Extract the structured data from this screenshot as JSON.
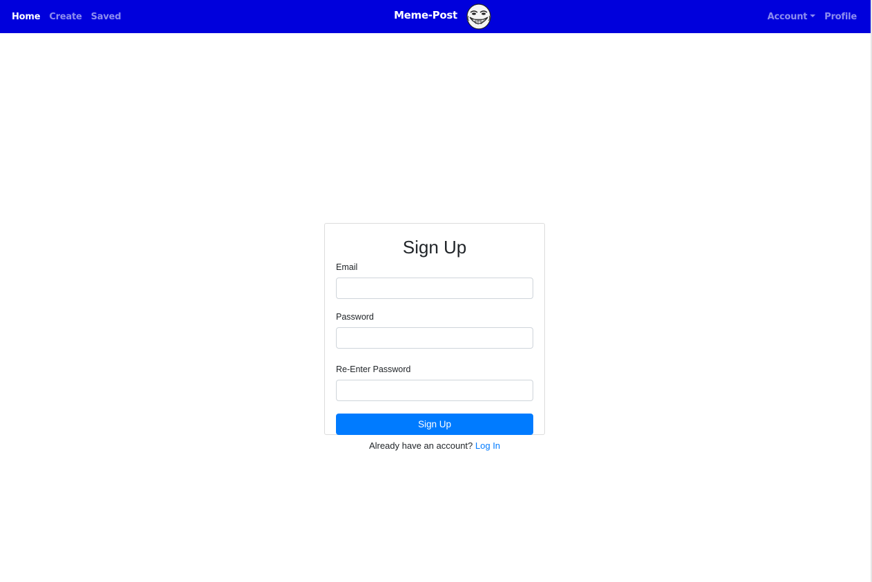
{
  "navbar": {
    "left_links": [
      {
        "label": "Home",
        "active": true
      },
      {
        "label": "Create",
        "active": false
      },
      {
        "label": "Saved",
        "active": false
      }
    ],
    "brand": "Meme-Post",
    "brand_logo_icon": "trollface-icon",
    "account_label": "Account",
    "profile_label": "Profile",
    "background_color": "#0000dc"
  },
  "form": {
    "title": "Sign Up",
    "email_label": "Email",
    "email_value": "",
    "password_label": "Password",
    "password_value": "",
    "reenter_label": "Re-Enter Password",
    "reenter_value": "",
    "submit_label": "Sign Up",
    "submit_color": "#007bff"
  },
  "footer": {
    "prompt": "Already have an account?",
    "login_label": "Log In"
  }
}
